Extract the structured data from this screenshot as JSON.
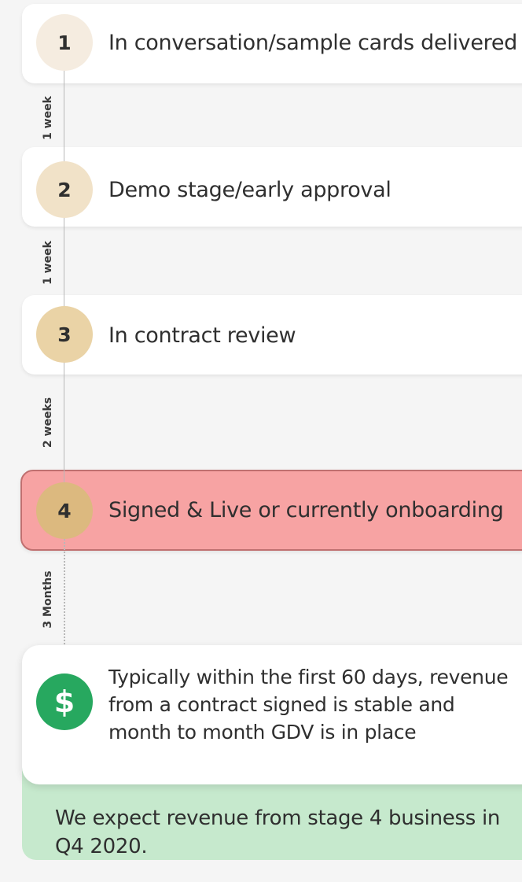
{
  "stages": [
    {
      "number": "1",
      "label": "In conversation/sample cards delivered",
      "color": "#f5ece0"
    },
    {
      "number": "2",
      "label": "Demo stage/early approval",
      "color": "#f1e2c8"
    },
    {
      "number": "3",
      "label": "In contract review",
      "color": "#ead3a6"
    },
    {
      "number": "4",
      "label": "Signed & Live or currently onboarding",
      "color": "#dcb97f"
    }
  ],
  "durations": [
    "1 week",
    "1 week",
    "2 weeks",
    "3 Months"
  ],
  "revenue": {
    "icon": "dollar-icon",
    "symbol": "$",
    "text": "Typically within the first 60 days, revenue from a  contract signed is stable and month to month GDV is in place",
    "color": "#27a85f"
  },
  "expectation": "We expect revenue from stage 4 business in Q4  2020.",
  "highlight_color": "#f7a3a3"
}
